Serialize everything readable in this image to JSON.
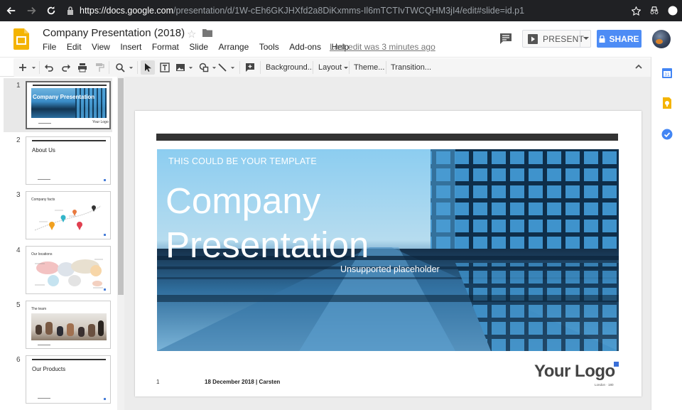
{
  "browser": {
    "url_host": "https://docs.google.com",
    "url_path": "/presentation/d/1W-cEh6GKJHXfd2a8DiKxmms-Il6mTCTIvTWCQHM3jI4/edit#slide=id.p1"
  },
  "header": {
    "title": "Company Presentation (2018)",
    "menu": [
      "File",
      "Edit",
      "View",
      "Insert",
      "Format",
      "Slide",
      "Arrange",
      "Tools",
      "Add-ons",
      "Help"
    ],
    "last_edit": "Last edit was 3 minutes ago",
    "present_label": "PRESENT",
    "share_label": "SHARE"
  },
  "toolbar": {
    "background_label": "Background...",
    "layout_label": "Layout",
    "theme_label": "Theme...",
    "transition_label": "Transition..."
  },
  "filmstrip": {
    "slides": [
      {
        "num": "1",
        "title": "Company Presentation",
        "logo": "Your Logo"
      },
      {
        "num": "2",
        "title": "About Us"
      },
      {
        "num": "3",
        "title": "Company facts"
      },
      {
        "num": "4",
        "title": "Our locations"
      },
      {
        "num": "5",
        "title": "The team"
      },
      {
        "num": "6",
        "title": "Our Products"
      }
    ]
  },
  "slide": {
    "kicker": "THIS COULD BE YOUR TEMPLATE",
    "title_line1": "Company",
    "title_line2": "Presentation",
    "placeholder": "Unsupported placeholder",
    "page_number": "1",
    "footer": "18 December 2018 | Carsten",
    "logo": "Your Logo",
    "logo_sub": "London · 180"
  },
  "colors": {
    "share_blue": "#4d8cf5",
    "logo_accent": "#3a6fd8",
    "slides_yellow": "#f4b400"
  }
}
